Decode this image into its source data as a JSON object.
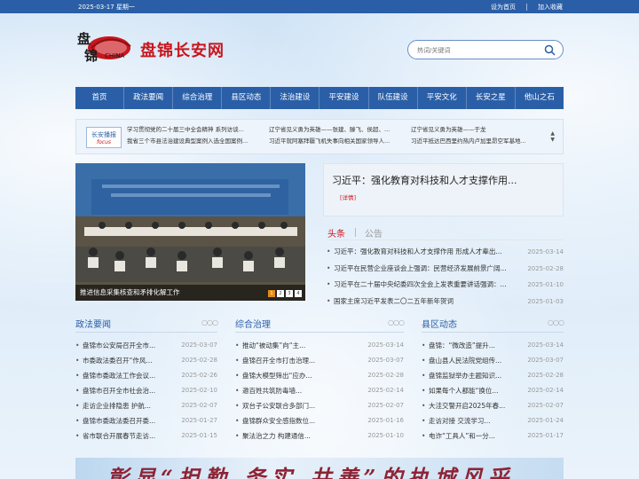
{
  "topbar": {
    "date": "2025-03-17 星期一",
    "set_home": "设为首页",
    "add_fav": "加入收藏"
  },
  "logo": {
    "site_name": "盘锦长安网",
    "emblem_chars": "盘锦",
    "emblem_en": "CHINA"
  },
  "search": {
    "placeholder": "热词/关键词"
  },
  "nav": {
    "items": [
      "首页",
      "政法要闻",
      "综合治理",
      "县区动态",
      "法治建设",
      "平安建设",
      "队伍建设",
      "平安文化",
      "长安之星",
      "他山之石"
    ]
  },
  "ticker": {
    "label_cn": "长安播报",
    "label_en": "focus",
    "col1": [
      "学习贯彻党的二十届三中全会精神 系列访谈...",
      "我省三个市县法治建设典型案例入选全国案例..."
    ],
    "col2": [
      "辽宁省见义勇为英雄——张建、滕飞、侯超、...",
      "习近平就阿塞拜疆飞机失事向相关国家领导人..."
    ],
    "col3": [
      "辽宁省见义勇为英雄——于龙",
      "习近平抵达巴西里约热内卢加里昂空军基地..."
    ]
  },
  "slider": {
    "caption": "推进信息采集核查和矛排化解工作",
    "dots": [
      "1",
      "2",
      "3",
      "4"
    ]
  },
  "headline": {
    "title": "习近平：强化教育对科技和人才支撑作用...",
    "more": "[详情]"
  },
  "tabs": {
    "tab1": "头条",
    "tab2": "公告"
  },
  "headlines": [
    {
      "text": "习近平：强化教育对科技和人才支撑作用 形成人才辈出...",
      "date": "2025-03-14"
    },
    {
      "text": "习近平在民营企业座谈会上强调：民营经济发展前景广阔...",
      "date": "2025-02-28"
    },
    {
      "text": "习近平在二十届中央纪委四次全会上发表重要讲话强调：...",
      "date": "2025-01-10"
    },
    {
      "text": "国家主席习近平发表二〇二五年新年贺词",
      "date": "2025-01-03"
    }
  ],
  "sections": [
    {
      "title": "政法要闻",
      "items": [
        {
          "text": "盘锦市公安局召开全市...",
          "date": "2025-03-07"
        },
        {
          "text": "市委政法委召开“作风...",
          "date": "2025-02-28"
        },
        {
          "text": "盘锦市委政法工作会议...",
          "date": "2025-02-26"
        },
        {
          "text": "盘锦市召开全市社会治...",
          "date": "2025-02-10"
        },
        {
          "text": "走访企业排隐患 护航...",
          "date": "2025-02-07"
        },
        {
          "text": "盘锦市委政法委召开委...",
          "date": "2025-01-27"
        },
        {
          "text": "省市联合开展春节走访...",
          "date": "2025-01-15"
        }
      ]
    },
    {
      "title": "综合治理",
      "items": [
        {
          "text": "推动“被动集”向“主...",
          "date": "2025-03-14"
        },
        {
          "text": "盘锦召开全市打击治理...",
          "date": "2025-03-07"
        },
        {
          "text": "盘锦大模型筛出“应办...",
          "date": "2025-02-28"
        },
        {
          "text": "邀百姓共筑防毒墙...",
          "date": "2025-02-14"
        },
        {
          "text": "双台子公安联合多部门...",
          "date": "2025-02-07"
        },
        {
          "text": "盘锦群众安全感指数位...",
          "date": "2025-01-16"
        },
        {
          "text": "聚法治之力 构建通信...",
          "date": "2025-01-10"
        }
      ]
    },
    {
      "title": "县区动态",
      "items": [
        {
          "text": "盘锦：“微改造”提升...",
          "date": "2025-03-14"
        },
        {
          "text": "盘山县人民法院党组传...",
          "date": "2025-03-07"
        },
        {
          "text": "盘锦监狱举办主题知识...",
          "date": "2025-02-28"
        },
        {
          "text": "如果每个人都能“换位...",
          "date": "2025-02-14"
        },
        {
          "text": "大洼交警开启2025年春...",
          "date": "2025-02-07"
        },
        {
          "text": "走访对接 交流学习...",
          "date": "2025-01-24"
        },
        {
          "text": "电诈“工具人”和一分...",
          "date": "2025-01-17"
        }
      ]
    }
  ],
  "banner": {
    "text": "彰显“担勤 务实 共善”的执城风采"
  },
  "colors": {
    "brand_blue": "#2a5fa8",
    "brand_red": "#c8161d"
  }
}
